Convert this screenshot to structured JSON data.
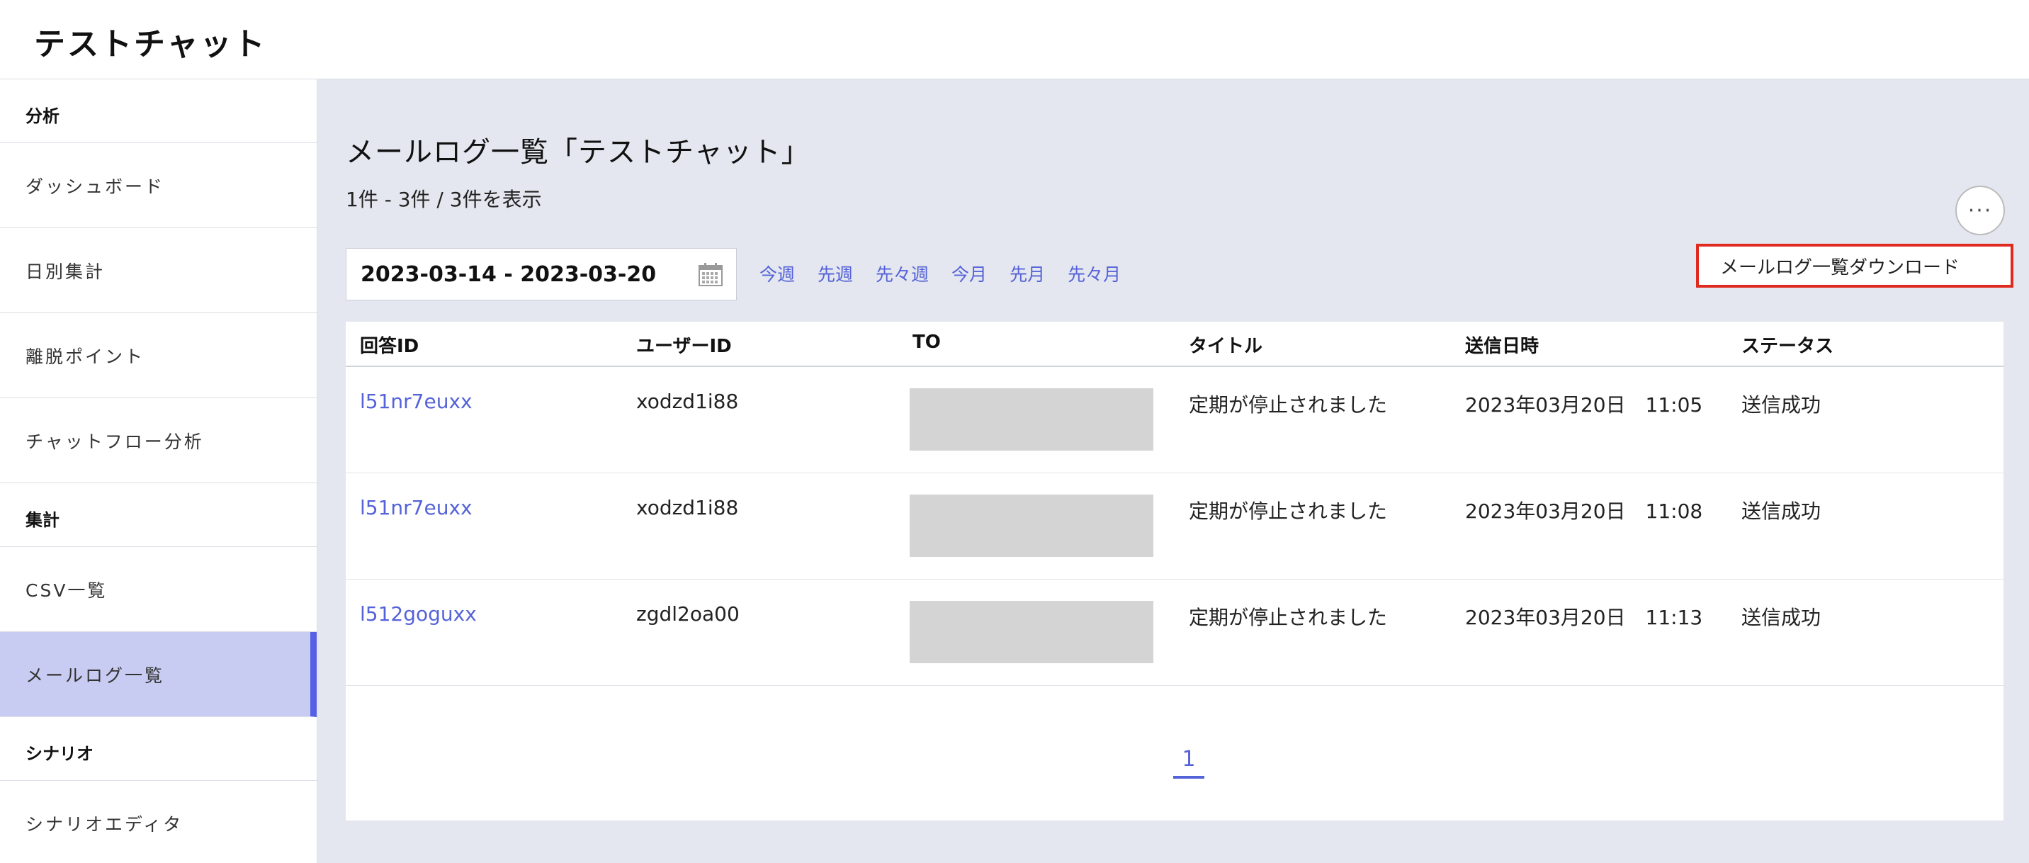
{
  "app": {
    "title": "テストチャット"
  },
  "sidebar": {
    "items": [
      {
        "type": "section",
        "label": "分析"
      },
      {
        "type": "item",
        "label": "ダッシュボード"
      },
      {
        "type": "item",
        "label": "日別集計"
      },
      {
        "type": "item",
        "label": "離脱ポイント"
      },
      {
        "type": "item",
        "label": "チャットフロー分析"
      },
      {
        "type": "section",
        "label": "集計"
      },
      {
        "type": "item",
        "label": "CSV一覧"
      },
      {
        "type": "item",
        "label": "メールログ一覧",
        "active": true
      },
      {
        "type": "section",
        "label": "シナリオ"
      },
      {
        "type": "item",
        "label": "シナリオエディタ"
      }
    ]
  },
  "main": {
    "title": "メールログ一覧「テストチャット」",
    "count": "1件 - 3件 / 3件を表示",
    "more_label": "···",
    "menu_item": "メールログ一覧ダウンロード",
    "date_range": "2023-03-14 - 2023-03-20",
    "quick_links": [
      "今週",
      "先週",
      "先々週",
      "今月",
      "先月",
      "先々月"
    ],
    "table": {
      "headers": [
        "回答ID",
        "ユーザーID",
        "TO",
        "タイトル",
        "送信日時",
        "ステータス"
      ],
      "rows": [
        {
          "answer_id": "l51nr7euxx",
          "user_id": "xodzd1i88",
          "title": "定期が停止されました",
          "sent_at": "2023年03月20日　11:05",
          "status": "送信成功"
        },
        {
          "answer_id": "l51nr7euxx",
          "user_id": "xodzd1i88",
          "title": "定期が停止されました",
          "sent_at": "2023年03月20日　11:08",
          "status": "送信成功"
        },
        {
          "answer_id": "l512goguxx",
          "user_id": "zgdl2oa00",
          "title": "定期が停止されました",
          "sent_at": "2023年03月20日　11:13",
          "status": "送信成功"
        }
      ]
    },
    "pagination": {
      "current": "1"
    }
  },
  "colors": {
    "accent": "#5563d8",
    "active_bg": "#c9ccf2",
    "highlight": "#e02a1f",
    "main_bg": "#e4e7ef"
  }
}
